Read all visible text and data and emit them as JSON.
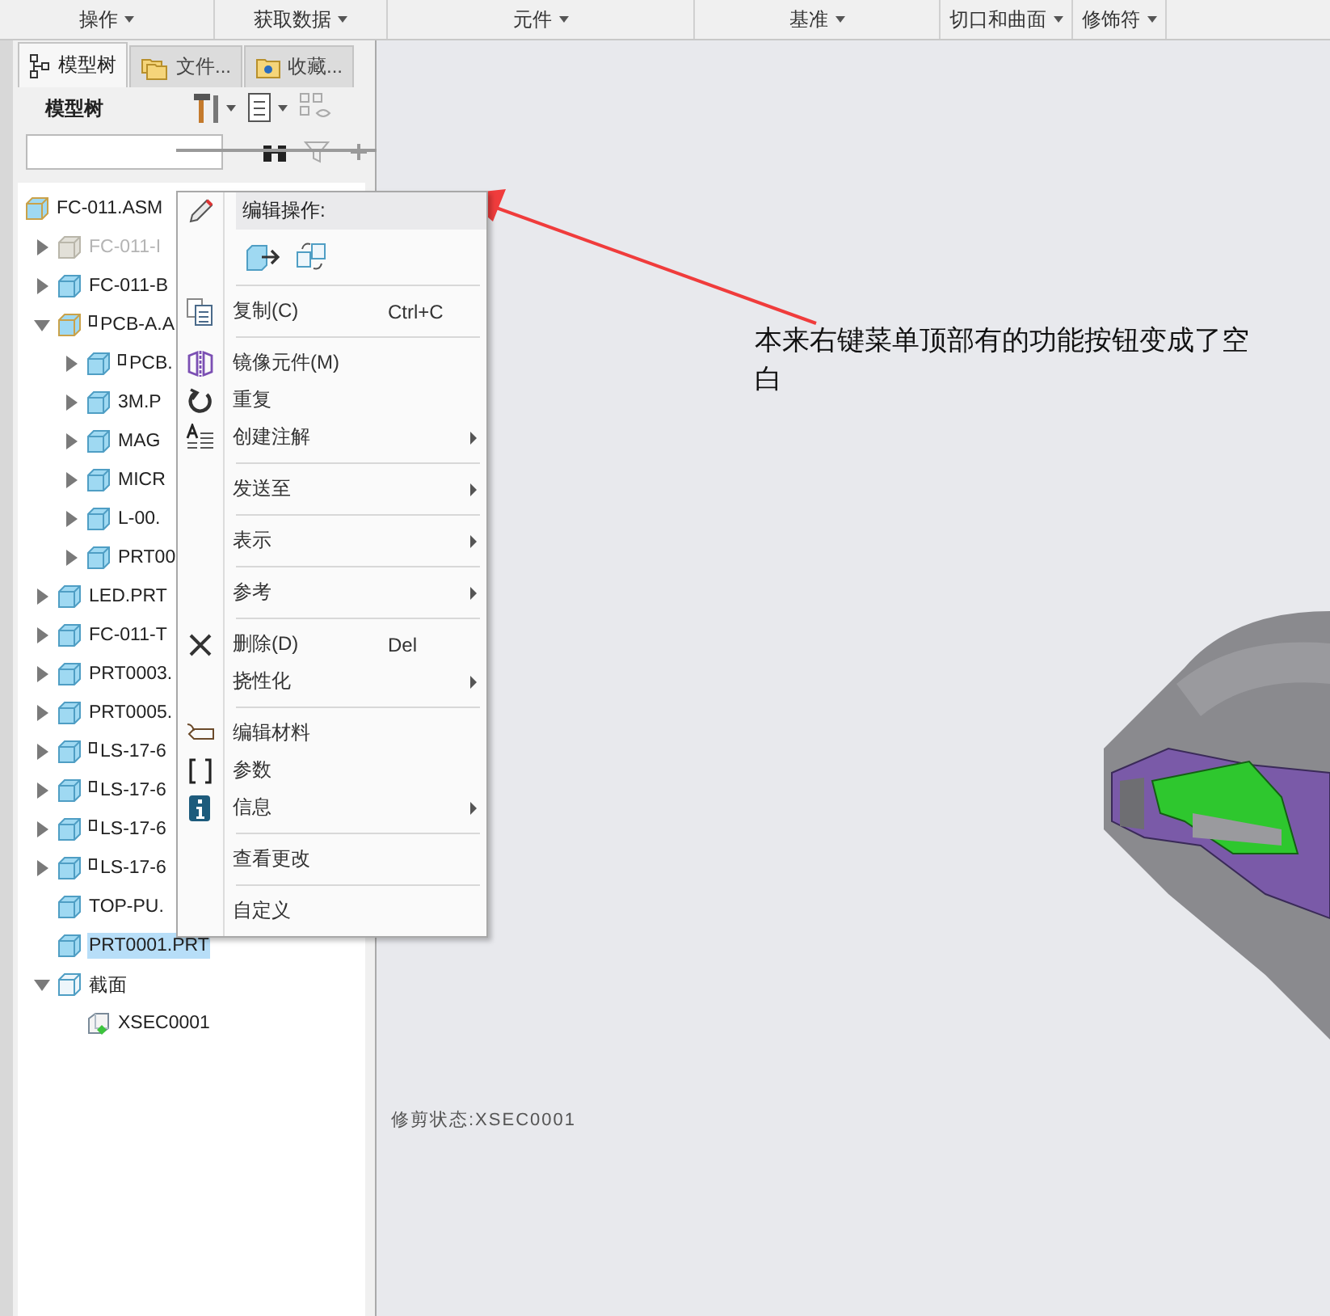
{
  "ribbon_groups": [
    {
      "label": "操作"
    },
    {
      "label": "获取数据"
    },
    {
      "label": "元件"
    },
    {
      "label": "基准"
    },
    {
      "label": "切口和曲面"
    },
    {
      "label": "修饰符"
    }
  ],
  "panel": {
    "tabs": [
      {
        "label": "模型树",
        "kind": "tree",
        "selected": true
      },
      {
        "label": "文件...",
        "kind": "folder",
        "selected": false
      },
      {
        "label": "收藏...",
        "kind": "favorite",
        "selected": false
      }
    ],
    "title": "模型树"
  },
  "tree": [
    {
      "label": "FC-011.ASM",
      "kind": "asm",
      "disabled": false,
      "selected": false,
      "marked": false,
      "children": [
        {
          "label": "FC-011-I",
          "kind": "part",
          "expanded": false,
          "disabled": true,
          "selected": false,
          "marked": false
        },
        {
          "label": "FC-011-B",
          "kind": "part",
          "expanded": false,
          "disabled": false,
          "selected": false,
          "marked": false
        },
        {
          "label": "PCB-A.A",
          "kind": "asm",
          "expanded": true,
          "disabled": false,
          "selected": false,
          "marked": true,
          "children": [
            {
              "label": "PCB.",
              "kind": "part",
              "expanded": false,
              "disabled": false,
              "selected": false,
              "marked": true
            },
            {
              "label": "3M.P",
              "kind": "part",
              "expanded": false,
              "disabled": false,
              "selected": false,
              "marked": false
            },
            {
              "label": "MAG",
              "kind": "part",
              "expanded": false,
              "disabled": false,
              "selected": false,
              "marked": false
            },
            {
              "label": "MICR",
              "kind": "part",
              "expanded": false,
              "disabled": false,
              "selected": false,
              "marked": false
            },
            {
              "label": "L-00.",
              "kind": "part",
              "expanded": false,
              "disabled": false,
              "selected": false,
              "marked": false
            },
            {
              "label": "PRT00",
              "kind": "part",
              "expanded": false,
              "disabled": false,
              "selected": false,
              "marked": false
            }
          ]
        },
        {
          "label": "LED.PRT",
          "kind": "part",
          "expanded": false,
          "disabled": false,
          "selected": false,
          "marked": false
        },
        {
          "label": "FC-011-T",
          "kind": "part",
          "expanded": false,
          "disabled": false,
          "selected": false,
          "marked": false
        },
        {
          "label": "PRT0003.",
          "kind": "part",
          "expanded": false,
          "disabled": false,
          "selected": false,
          "marked": false
        },
        {
          "label": "PRT0005.",
          "kind": "part",
          "expanded": false,
          "disabled": false,
          "selected": false,
          "marked": false
        },
        {
          "label": "LS-17-6",
          "kind": "part",
          "expanded": false,
          "disabled": false,
          "selected": false,
          "marked": true
        },
        {
          "label": "LS-17-6",
          "kind": "part",
          "expanded": false,
          "disabled": false,
          "selected": false,
          "marked": true
        },
        {
          "label": "LS-17-6",
          "kind": "part",
          "expanded": false,
          "disabled": false,
          "selected": false,
          "marked": true
        },
        {
          "label": "LS-17-6",
          "kind": "part",
          "expanded": false,
          "disabled": false,
          "selected": false,
          "marked": true
        },
        {
          "label": "TOP-PU.",
          "kind": "part",
          "disabled": false,
          "selected": false,
          "marked": false
        },
        {
          "label": "PRT0001.PRT",
          "kind": "part",
          "disabled": false,
          "selected": true,
          "marked": false
        },
        {
          "label": "截面",
          "kind": "section",
          "expanded": true,
          "disabled": false,
          "selected": false,
          "marked": false,
          "children": [
            {
              "label": "XSEC0001",
              "kind": "xsec",
              "disabled": false,
              "selected": false,
              "marked": false
            }
          ]
        }
      ]
    }
  ],
  "context_menu": {
    "header": "编辑操作:",
    "sections": [
      [
        {
          "label": "复制(C)",
          "shortcut": "Ctrl+C",
          "kind": "copy",
          "submenu": false
        }
      ],
      [
        {
          "label": "镜像元件(M)",
          "kind": "mirror",
          "submenu": false
        },
        {
          "label": "重复",
          "kind": "repeat",
          "submenu": false
        },
        {
          "label": "创建注解",
          "kind": "annotate",
          "submenu": true
        }
      ],
      [
        {
          "label": "发送至",
          "kind": "none",
          "submenu": true
        }
      ],
      [
        {
          "label": "表示",
          "kind": "none",
          "submenu": true
        }
      ],
      [
        {
          "label": "参考",
          "kind": "none",
          "submenu": true
        }
      ],
      [
        {
          "label": "删除(D)",
          "shortcut": "Del",
          "kind": "delete",
          "submenu": false
        },
        {
          "label": "挠性化",
          "kind": "none",
          "submenu": true
        }
      ],
      [
        {
          "label": "编辑材料",
          "kind": "material",
          "submenu": false
        },
        {
          "label": "参数",
          "kind": "params",
          "submenu": false
        },
        {
          "label": "信息",
          "kind": "info",
          "submenu": true
        }
      ],
      [
        {
          "label": "查看更改",
          "kind": "none",
          "submenu": false
        }
      ],
      [
        {
          "label": "自定义",
          "kind": "none",
          "submenu": false
        }
      ]
    ]
  },
  "note": "本来右键菜单顶部有的功能按钮变成了空白",
  "section_state": "修剪状态:XSEC0001"
}
